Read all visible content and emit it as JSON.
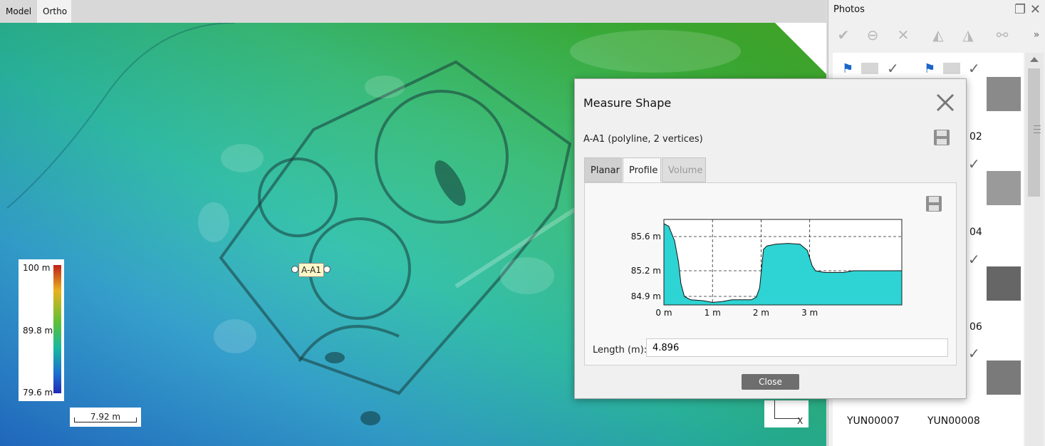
{
  "view_tabs": [
    {
      "label": "Model"
    },
    {
      "label": "Ortho"
    }
  ],
  "legend": {
    "max": "100 m",
    "mid": "89.8 m",
    "min": "79.6 m"
  },
  "scale_bar": "7.92 m",
  "axis_label": "X",
  "marker_label": "A-A1",
  "photos_panel": {
    "title": "Photos",
    "toolbar": [
      "check-icon",
      "minus-icon",
      "close-icon",
      "sharpen-icon",
      "blur-icon",
      "binoculars-icon",
      "more-icon"
    ],
    "items": [
      {
        "name": "YUN00007"
      },
      {
        "name": "YUN00008"
      }
    ],
    "partial_labels": [
      "02",
      "04",
      "06"
    ]
  },
  "dialog": {
    "title": "Measure Shape",
    "subtitle": "A-A1 (polyline, 2 vertices)",
    "tabs": [
      {
        "label": "Planar"
      },
      {
        "label": "Profile"
      },
      {
        "label": "Volume"
      }
    ],
    "length_label": "Length (m):",
    "length_value": "4.896",
    "close_label": "Close"
  },
  "chart_data": {
    "type": "area",
    "title": "",
    "xlabel": "",
    "ylabel": "",
    "x_ticks": [
      "0 m",
      "1 m",
      "2 m",
      "3 m"
    ],
    "y_ticks": [
      "85.6 m",
      "85.2 m",
      "84.9 m"
    ],
    "xlim": [
      0,
      4.896
    ],
    "ylim": [
      84.8,
      85.8
    ],
    "grid": true,
    "series": [
      {
        "color": "#2ed3d3",
        "x": [
          0,
          0.1,
          0.22,
          0.3,
          0.35,
          0.42,
          0.55,
          0.8,
          1.0,
          1.2,
          1.4,
          1.6,
          1.8,
          1.9,
          1.97,
          2.05,
          2.12,
          2.3,
          2.55,
          2.8,
          2.95,
          3.05,
          3.12,
          3.3,
          3.5,
          3.7,
          3.9
        ],
        "y": [
          85.75,
          85.72,
          85.55,
          85.3,
          85.05,
          84.9,
          84.86,
          84.85,
          84.83,
          84.84,
          84.86,
          84.86,
          84.86,
          84.89,
          85.0,
          85.45,
          85.49,
          85.51,
          85.52,
          85.51,
          85.44,
          85.26,
          85.2,
          85.18,
          85.18,
          85.18,
          85.2
        ]
      }
    ]
  }
}
